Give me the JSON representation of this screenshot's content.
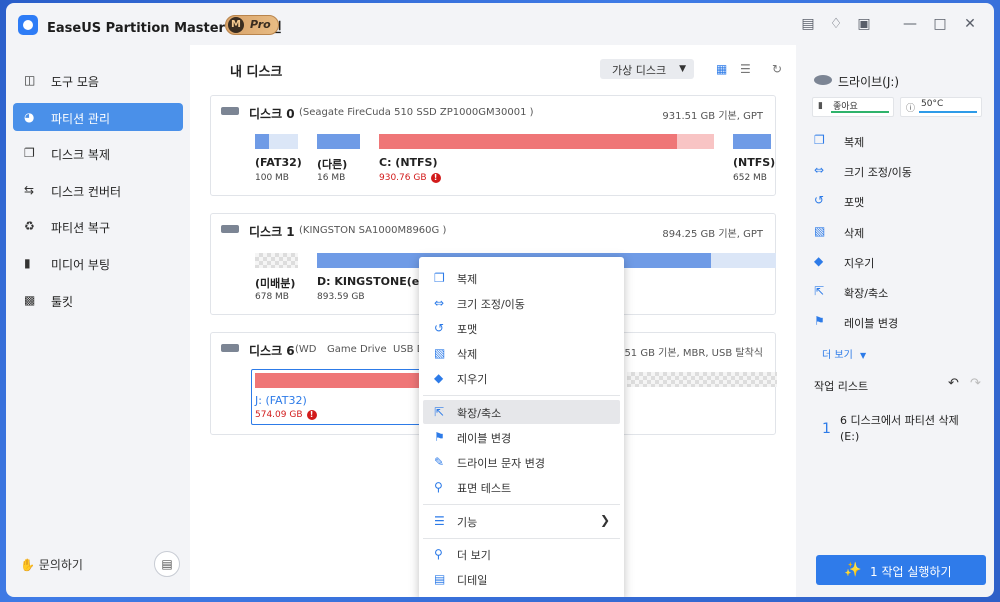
{
  "app": {
    "title": "EaseUS Partition Master 프로 버전",
    "pro_letter": "M",
    "pro_label": "Pro"
  },
  "sidebar": {
    "items": [
      {
        "label": "도구 모음"
      },
      {
        "label": "파티션 관리"
      },
      {
        "label": "디스크 복제"
      },
      {
        "label": "디스크 컨버터"
      },
      {
        "label": "파티션 복구"
      },
      {
        "label": "미디어 부팅"
      },
      {
        "label": "툴킷"
      }
    ],
    "help": "문의하기"
  },
  "main": {
    "title": "내 디스크",
    "virtual_label": "가상 디스크",
    "disks": [
      {
        "name": "디스크 0",
        "model": "(Seagate FireCuda 510 SSD ZP1000GM30001 )",
        "size": "931.51 GB 기본, GPT",
        "partitions": [
          {
            "name": "(FAT32)",
            "size": "100 MB"
          },
          {
            "name": "(다른)",
            "size": "16 MB"
          },
          {
            "name": "C: (NTFS)",
            "size": "930.76 GB"
          },
          {
            "name": "(NTFS)",
            "size": "652 MB"
          }
        ]
      },
      {
        "name": "디스크 1",
        "model": "(KINGSTON SA1000M8960G )",
        "size": "894.25 GB 기본, GPT",
        "partitions": [
          {
            "name": "(미배분)",
            "size": "678 MB"
          },
          {
            "name": "D: KINGSTONE(exFAT",
            "size": "893.59 GB"
          }
        ]
      },
      {
        "name": "디스크 6",
        "model": "(WD",
        "model2": "Game Drive",
        "model3": "USB De",
        "size": "931.51 GB 기본, MBR, USB 탈착식",
        "partitions": [
          {
            "name": "J: (FAT32)",
            "size": "574.09 GB"
          }
        ]
      }
    ]
  },
  "context_menu": {
    "items": [
      {
        "label": "복제",
        "icon": "clone-icon"
      },
      {
        "label": "크기 조정/이동",
        "icon": "resize-icon"
      },
      {
        "label": "포맷",
        "icon": "format-icon"
      },
      {
        "label": "삭제",
        "icon": "trash-icon"
      },
      {
        "label": "지우기",
        "icon": "eraser-icon"
      },
      {
        "label": "확장/축소",
        "icon": "extend-icon"
      },
      {
        "label": "레이블 변경",
        "icon": "tag-icon"
      },
      {
        "label": "드라이브 문자 변경",
        "icon": "pencil-icon"
      },
      {
        "label": "표면 테스트",
        "icon": "surface-test-icon"
      },
      {
        "label": "기능",
        "icon": "sliders-icon"
      },
      {
        "label": "더 보기",
        "icon": "more-icon"
      },
      {
        "label": "디테일",
        "icon": "detail-icon"
      }
    ]
  },
  "right_panel": {
    "drive": "드라이브(J:)",
    "health": "좋아요",
    "temp": "50°C",
    "actions": [
      {
        "label": "복제"
      },
      {
        "label": "크기 조정/이동"
      },
      {
        "label": "포맷"
      },
      {
        "label": "삭제"
      },
      {
        "label": "지우기"
      },
      {
        "label": "확장/축소"
      },
      {
        "label": "레이블 변경"
      }
    ],
    "more": "더 보기",
    "ops_title": "작업 리스트",
    "op_number": "1",
    "op_text": "6 디스크에서 파티션 삭제(E:)",
    "execute": "1 작업 실행하기"
  },
  "colors": {
    "accent": "#2f7bea",
    "sidebar_active": "#4a90e9",
    "partition_blue": "#6f9be6",
    "partition_blue_light": "#dbe6f7",
    "partition_red": "#ef7677",
    "partition_red_light": "#f8c4c4",
    "warning_red": "#d21b1b"
  }
}
